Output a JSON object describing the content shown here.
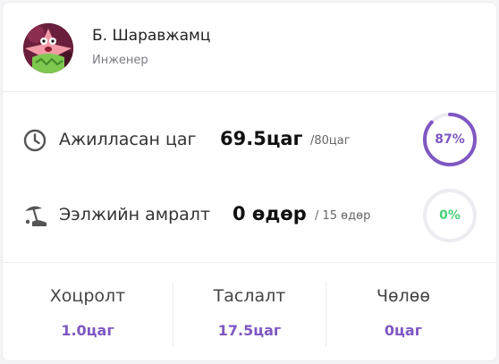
{
  "profile": {
    "name": "Б. Шаравжамц",
    "role": "Инженер",
    "avatar_icon": "patrick-star-avatar"
  },
  "stats": {
    "worked": {
      "label": "Ажилласан цаг",
      "value": "69.5цаг",
      "total": "/80цаг",
      "percent_text": "87%",
      "percent": 87,
      "color": "#7e57c2",
      "icon": "clock-icon"
    },
    "vacation": {
      "label": "Ээлжийн амралт",
      "value": "0 өдөр",
      "total": "/ 15 өдөр",
      "percent_text": "0%",
      "percent": 0,
      "color": "#4cd17a",
      "icon": "beach-umbrella-icon"
    }
  },
  "summary": [
    {
      "title": "Хоцролт",
      "value": "1.0цаг"
    },
    {
      "title": "Таслалт",
      "value": "17.5цаг"
    },
    {
      "title": "Чөлөө",
      "value": "0цаг"
    }
  ],
  "colors": {
    "accent": "#7e57c2",
    "success": "#4cd17a",
    "ring_track": "#ececf0"
  }
}
